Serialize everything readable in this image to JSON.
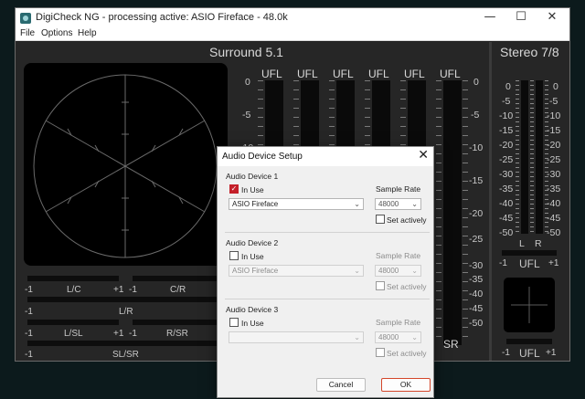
{
  "window": {
    "title": "DigiCheck NG - processing active: ASIO Fireface - 48.0k",
    "controls": {
      "minimize": "—",
      "maximize": "☐",
      "close": "✕"
    }
  },
  "menu": [
    "File",
    "Options",
    "Help"
  ],
  "surround": {
    "title": "Surround 5.1",
    "channels": [
      "UFL",
      "UFL",
      "UFL",
      "UFL",
      "UFL",
      "UFL"
    ],
    "left_scale": [
      "0",
      "-5",
      "-10"
    ],
    "right_scale": [
      "0",
      "-5",
      "-10",
      "-15",
      "-20",
      "-25",
      "-30",
      "-35",
      "-40",
      "-45",
      "-50"
    ],
    "bottom_channel_label": "SR",
    "balance_rows": [
      {
        "left_min": "-1",
        "left_label": "L/C",
        "left_max": "+1",
        "right_min": "-1",
        "right_label": "C/R"
      },
      {
        "min": "-1",
        "label": "L/R"
      },
      {
        "left_min": "-1",
        "left_label": "L/SL",
        "left_max": "+1",
        "right_min": "-1",
        "right_label": "R/SR"
      },
      {
        "min": "-1",
        "label": "SL/SR"
      }
    ]
  },
  "stereo": {
    "title": "Stereo 7/8",
    "scale": [
      "0",
      "-5",
      "-10",
      "-15",
      "-20",
      "-25",
      "-30",
      "-35",
      "-40",
      "-45",
      "-50"
    ],
    "channel_labels": [
      "L",
      "R"
    ],
    "correlation": {
      "min": "-1",
      "label": "UFL",
      "max": "+1"
    },
    "mini_correlation": {
      "min": "-1",
      "label": "UFL",
      "max": "+1"
    }
  },
  "dialog": {
    "title": "Audio Device Setup",
    "close": "✕",
    "devices": [
      {
        "title": "Audio Device 1",
        "in_use_label": "In Use",
        "in_use": true,
        "device": "ASIO Fireface",
        "sample_rate_label": "Sample Rate",
        "sample_rate": "48000",
        "set_actively_label": "Set actively",
        "enabled": true
      },
      {
        "title": "Audio Device 2",
        "in_use_label": "In Use",
        "in_use": false,
        "device": "ASIO Fireface",
        "sample_rate_label": "Sample Rate",
        "sample_rate": "48000",
        "set_actively_label": "Set actively",
        "enabled": false
      },
      {
        "title": "Audio Device 3",
        "in_use_label": "In Use",
        "in_use": false,
        "device": "",
        "sample_rate_label": "Sample Rate",
        "sample_rate": "48000",
        "set_actively_label": "Set actively",
        "enabled": false
      }
    ],
    "cancel_label": "Cancel",
    "ok_label": "OK"
  }
}
